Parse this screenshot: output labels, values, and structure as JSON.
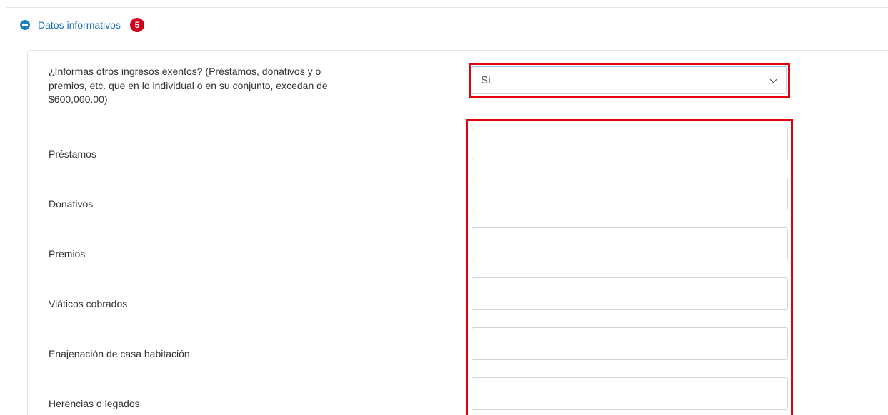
{
  "section": {
    "title": "Datos informativos",
    "badge_count": "5",
    "toggle_icon": "minus-circle-icon",
    "accent_color": "#1c7ec2",
    "badge_color": "#d0021b"
  },
  "question": {
    "label": "¿Informas otros ingresos exentos? (Préstamos, donativos y o premios, etc. que en lo individual o en su conjunto, excedan de $600,000.00)",
    "selected_value": "Sí"
  },
  "fields": [
    {
      "label": "Préstamos",
      "value": ""
    },
    {
      "label": "Donativos",
      "value": ""
    },
    {
      "label": "Premios",
      "value": ""
    },
    {
      "label": "Viáticos cobrados",
      "value": ""
    },
    {
      "label": "Enajenación de casa habitación",
      "value": ""
    },
    {
      "label": "Herencias o legados",
      "value": ""
    }
  ],
  "highlight_color": "#e3000f"
}
